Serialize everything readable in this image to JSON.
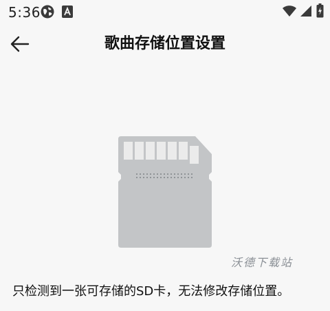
{
  "status_bar": {
    "time": "5:36",
    "left_icons": [
      "globe-icon",
      "font-a-icon"
    ],
    "right_icons": [
      "wifi-icon",
      "signal-icon",
      "battery-icon"
    ]
  },
  "app_bar": {
    "back_icon": "arrow-left-icon",
    "title": "歌曲存储位置设置"
  },
  "illustration": {
    "icon": "sd-card-icon",
    "card_color": "#c3c5c7",
    "contact_color": "#ebebeb"
  },
  "watermark": "沃德下载站",
  "message": "只检测到一张可存储的SD卡，无法修改存储位置。",
  "colors": {
    "background": "#f7f7f7",
    "text": "#111111",
    "watermark": "#8a8f95"
  }
}
